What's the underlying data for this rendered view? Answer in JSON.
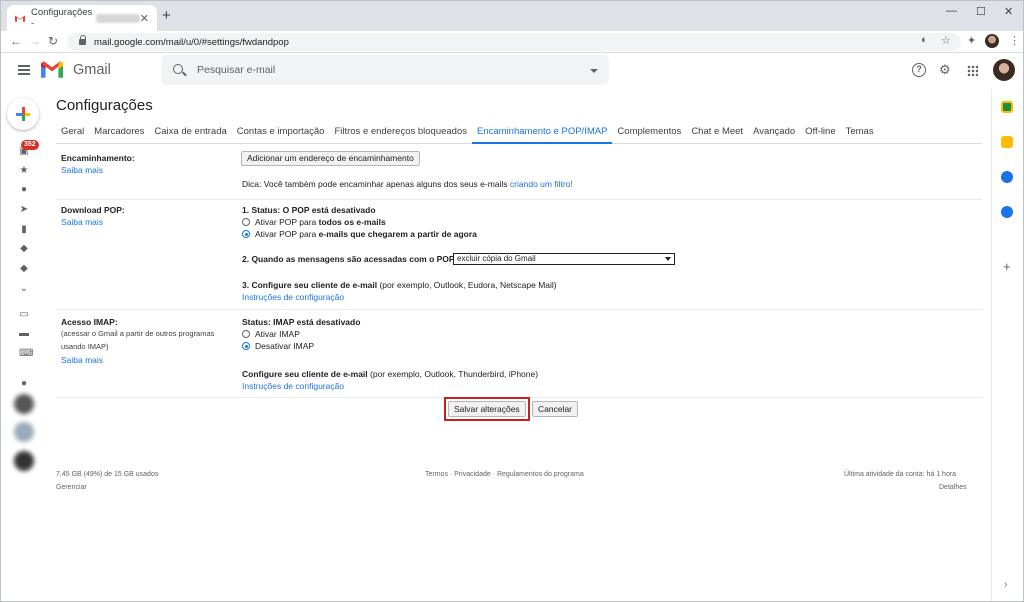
{
  "browser": {
    "tab_title": "Configurações -",
    "url": "mail.google.com/mail/u/0/#settings/fwdandpop"
  },
  "header": {
    "app_name": "Gmail",
    "search_placeholder": "Pesquisar e-mail"
  },
  "rail": {
    "inbox_badge": "352"
  },
  "page": {
    "title": "Configurações",
    "tabs": [
      {
        "label": "Geral"
      },
      {
        "label": "Marcadores"
      },
      {
        "label": "Caixa de entrada"
      },
      {
        "label": "Contas e importação"
      },
      {
        "label": "Filtros e endereços bloqueados"
      },
      {
        "label": "Encaminhamento e POP/IMAP"
      },
      {
        "label": "Complementos"
      },
      {
        "label": "Chat e Meet"
      },
      {
        "label": "Avançado"
      },
      {
        "label": "Off-line"
      },
      {
        "label": "Temas"
      }
    ]
  },
  "forwarding": {
    "label": "Encaminhamento:",
    "learn_more": "Saiba mais",
    "add_button": "Adicionar um endereço de encaminhamento",
    "tip_text": "Dica: Você também pode encaminhar apenas alguns dos seus e-mails",
    "tip_link": "criando um filtro!"
  },
  "pop": {
    "label": "Download POP:",
    "learn_more": "Saiba mais",
    "status": "1. Status: O POP está desativado",
    "opt1_prefix": "Ativar POP para",
    "opt1_bold": "todos os e-mails",
    "opt2_prefix": "Ativar POP para",
    "opt2_bold": "e-mails que chegarem a partir de agora",
    "step2": "2. Quando as mensagens são acessadas com o POP",
    "step2_select": "excluir cópia do Gmail",
    "step3_bold": "3. Configure seu cliente de e-mail",
    "step3_rest": "(por exemplo, Outlook, Eudora, Netscape Mail)",
    "instructions": "Instruções de configuração"
  },
  "imap": {
    "label": "Acesso IMAP:",
    "desc_line1": "(acessar o Gmail a partir de outros programas",
    "desc_line2": "usando IMAP)",
    "learn_more": "Saiba mais",
    "status": "Status: IMAP está desativado",
    "opt1": "Ativar IMAP",
    "opt2": "Desativar IMAP",
    "configure_bold": "Configure seu cliente de e-mail",
    "configure_rest": "(por exemplo, Outlook, Thunderbird, iPhone)",
    "instructions": "Instruções de configuração"
  },
  "actions": {
    "save": "Salvar alterações",
    "cancel": "Cancelar"
  },
  "footer": {
    "storage": "7,45 GB (49%) de 15 GB usados",
    "manage": "Gerenciar",
    "links": "Termos · Privacidade · Regulamentos do programa",
    "last_activity": "Última atividade da conta: há 1 hora",
    "details": "Detalhes"
  },
  "colors": {
    "accent": "#1a73e8",
    "highlight": "#c5221f",
    "badge": "#d93025"
  }
}
